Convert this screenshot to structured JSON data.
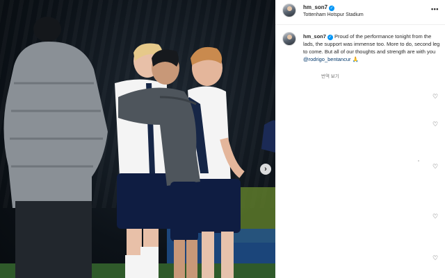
{
  "post": {
    "username": "hm_son7",
    "verified_icon": "verified-badge-icon",
    "location": "Tottenham Hotspur Stadium",
    "more_icon": "•••",
    "caption_text": "Proud of the performance tonight from the lads, the support was immense too. More to do, second leg to come. But all of our thoughts and strength are with you",
    "caption_mention": "@rodrigo_bentancur",
    "caption_emoji": "🙏",
    "translate_label": "번역 보기"
  },
  "carousel": {
    "next_icon": "›"
  },
  "comment_likes": {
    "icon": "heart-outline-icon",
    "glyph": "♡"
  },
  "colors": {
    "accent": "#0095f6",
    "mention": "#00376b",
    "muted": "#737373"
  }
}
